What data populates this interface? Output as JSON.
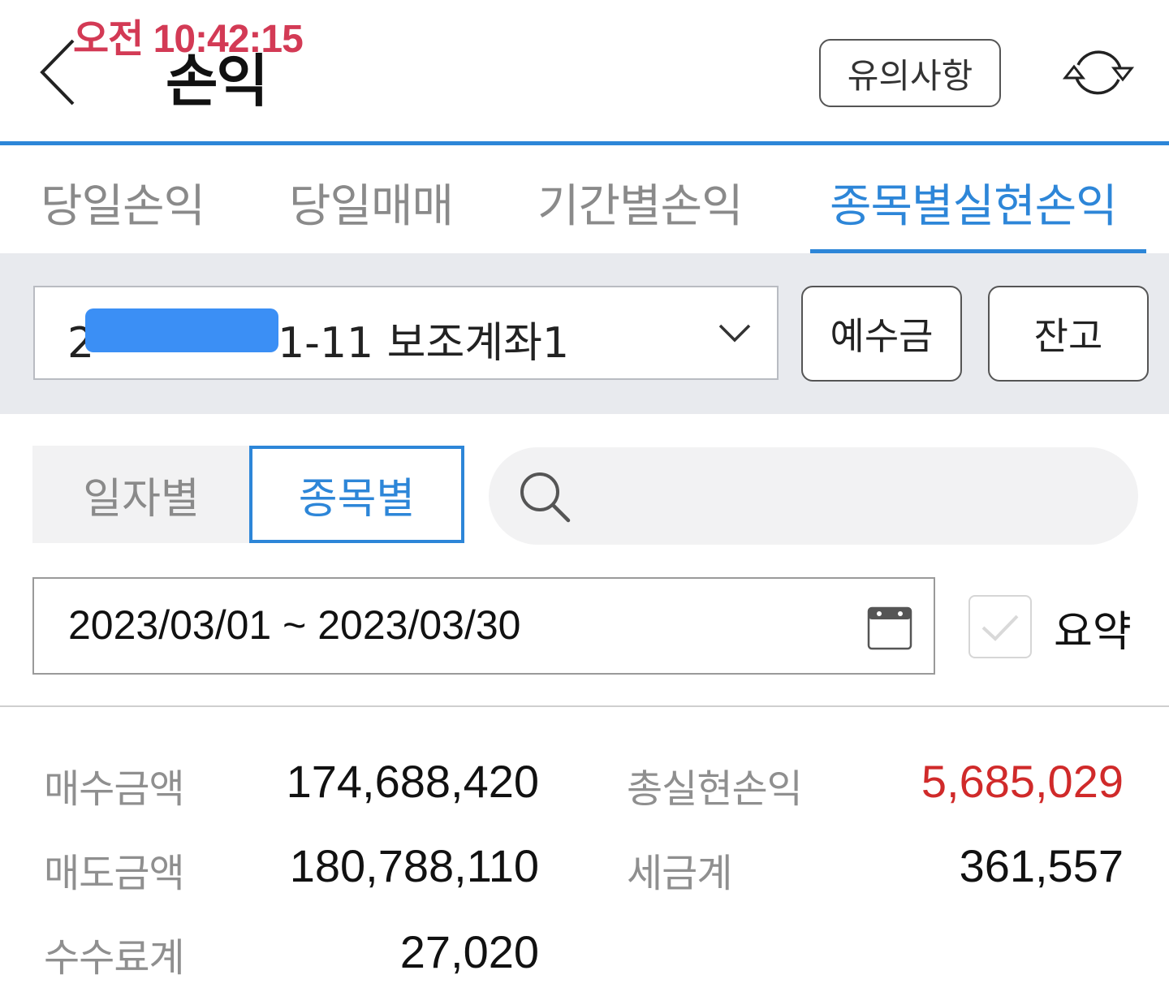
{
  "status": {
    "clock": "오전 10:42:15"
  },
  "header": {
    "title": "손익",
    "notice_label": "유의사항",
    "back_icon": "chevron-left-icon",
    "refresh_icon": "refresh-icon"
  },
  "tabs": [
    {
      "label": "당일손익",
      "active": false
    },
    {
      "label": "당일매매",
      "active": false
    },
    {
      "label": "기간별손익",
      "active": false
    },
    {
      "label": "종목별실현손익",
      "active": true
    }
  ],
  "account": {
    "visible_prefix": "2",
    "visible_suffix": "1-11 보조계좌1",
    "deposit_label": "예수금",
    "balance_label": "잔고"
  },
  "view_toggle": {
    "daily_label": "일자별",
    "stock_label": "종목별",
    "selected": "종목별"
  },
  "search": {
    "value": "",
    "placeholder": ""
  },
  "period": {
    "range": "2023/03/01 ~ 2023/03/30",
    "summary_label": "요약",
    "summary_checked": false
  },
  "stats": {
    "buy_amount_label": "매수금액",
    "buy_amount": "174,688,420",
    "sell_amount_label": "매도금액",
    "sell_amount": "180,788,110",
    "fee_total_label": "수수료계",
    "fee_total": "27,020",
    "total_realized_label": "총실현손익",
    "total_realized": "5,685,029",
    "tax_total_label": "세금계",
    "tax_total": "361,557"
  },
  "colors": {
    "accent": "#2d86d8",
    "profit": "#d02a2a",
    "clock": "#d33a55"
  }
}
